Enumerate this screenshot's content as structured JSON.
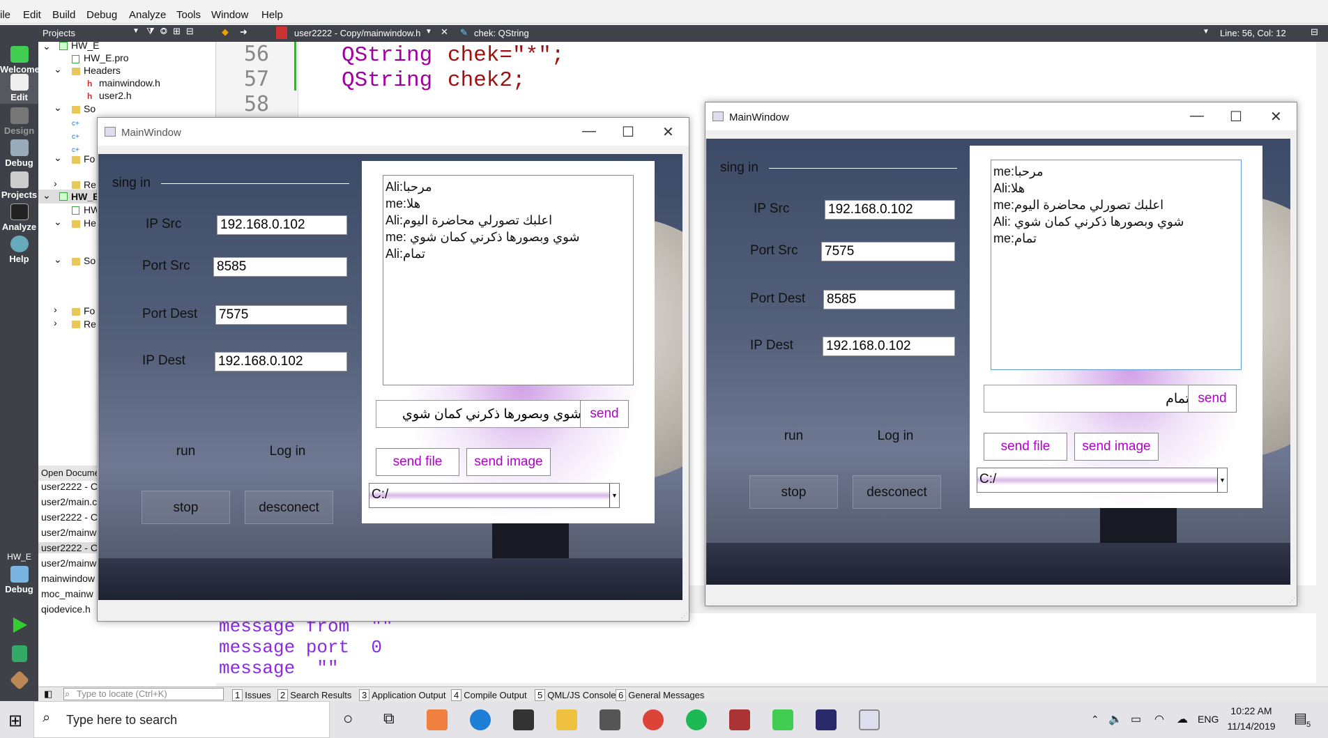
{
  "menu": [
    "ile",
    "Edit",
    "Build",
    "Debug",
    "Analyze",
    "Tools",
    "Window",
    "Help"
  ],
  "modes": [
    "Welcome",
    "Edit",
    "Design",
    "Debug",
    "Projects",
    "Analyze",
    "Help"
  ],
  "kit": {
    "project": "HW_E",
    "mode": "Debug"
  },
  "projects_label": "Projects",
  "editor_tabs": {
    "file": "user2222 - Copy/mainwindow.h",
    "symbol": "chek: QString",
    "position": "Line: 56, Col: 12"
  },
  "tree": [
    "HW_E",
    "HW_E.pro",
    "Headers",
    "mainwindow.h",
    "user2.h",
    "So",
    "Fo",
    "Re",
    "HW_E",
    "HW",
    "He",
    "So",
    "Fo",
    "Re"
  ],
  "open_documents": {
    "header": "Open Docume",
    "items": [
      "user2222 - C",
      "user2/main.c",
      "user2222 - C",
      "user2/mainw",
      "user2222 - C",
      "user2/mainw",
      "mainwindow",
      "moc_mainw",
      "qiodevice.h"
    ]
  },
  "code": {
    "lines": [
      {
        "num": "56",
        "type": "QString",
        "rest": "chek=\"*\";"
      },
      {
        "num": "57",
        "type": "QString",
        "rest": "chek2;"
      },
      {
        "num": "58",
        "type": "",
        "rest": ""
      }
    ]
  },
  "output": [
    "message from  \"\"",
    "message port  0",
    "message  \"\""
  ],
  "statusbar": {
    "locate_placeholder": "Type to locate (Ctrl+K)",
    "panes": [
      {
        "n": "1",
        "label": "Issues"
      },
      {
        "n": "2",
        "label": "Search Results"
      },
      {
        "n": "3",
        "label": "Application Output"
      },
      {
        "n": "4",
        "label": "Compile Output"
      },
      {
        "n": "5",
        "label": "QML/JS Console"
      },
      {
        "n": "6",
        "label": "General Messages"
      }
    ]
  },
  "taskbar": {
    "search_placeholder": "Type here to search",
    "time": "10:22 AM",
    "date": "11/14/2019",
    "lang": "ENG",
    "notifications": "5"
  },
  "win1": {
    "title": "MainWindow",
    "sign_in": "sing in",
    "ip_src_label": "IP Src",
    "ip_src": "192.168.0.102",
    "port_src_label": "Port Src",
    "port_src": "8585",
    "port_dest_label": "Port Dest",
    "port_dest": "7575",
    "ip_dest_label": "IP Dest",
    "ip_dest": "192.168.0.102",
    "run": "run",
    "login": "Log in",
    "stop": "stop",
    "disconnect": "desconect",
    "chat": [
      "Ali:مرحبا",
      "me:هلا",
      "Ali:اعلبك تصورلي محاضرة اليوم",
      "me: شوي  وبصورها ذكرني كمان شوي",
      "Ali:تمام"
    ],
    "message": "شوي  وبصورها ذكرني كمان شوي",
    "send": "send",
    "send_file": "send file",
    "send_image": "send image",
    "path": "C:/"
  },
  "win2": {
    "title": "MainWindow",
    "sign_in": "sing in",
    "ip_src_label": "IP Src",
    "ip_src": "192.168.0.102",
    "port_src_label": "Port Src",
    "port_src": "7575",
    "port_dest_label": "Port Dest",
    "port_dest": "8585",
    "ip_dest_label": "IP Dest",
    "ip_dest": "192.168.0.102",
    "run": "run",
    "login": "Log in",
    "stop": "stop",
    "disconnect": "desconect",
    "chat": [
      "me:مرحبا",
      "Ali:هلا",
      "me:اعلبك تصورلي محاضرة اليوم",
      "Ali: شوي  وبصورها ذكرني كمان شوي",
      "me:تمام"
    ],
    "message": "تمام",
    "send": "send",
    "send_file": "send file",
    "send_image": "send image",
    "path": "C:/"
  }
}
